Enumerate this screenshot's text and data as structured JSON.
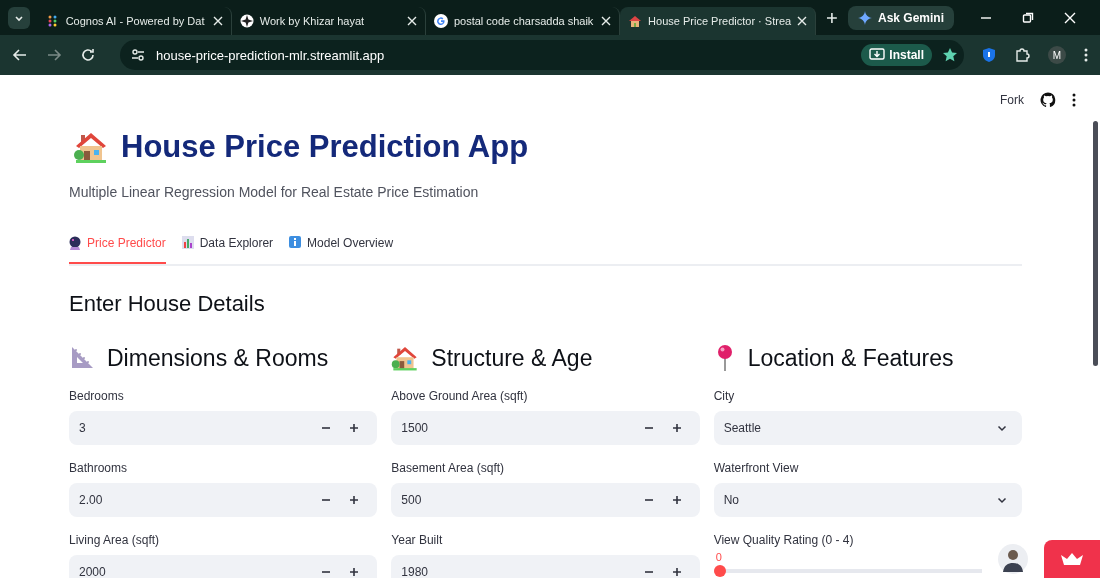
{
  "browser": {
    "tabs": [
      {
        "title": "Cognos AI - Powered by Dat",
        "selected": false
      },
      {
        "title": "Work by Khizar hayat",
        "selected": false
      },
      {
        "title": "postal code charsadda shaik",
        "selected": false
      },
      {
        "title": "House Price Predictor · Strea",
        "selected": true
      }
    ],
    "ask_button": "Ask Gemini",
    "address": "house-price-prediction-mlr.streamlit.app",
    "install_button": "Install",
    "profile_initial": "M"
  },
  "app_toolbar": {
    "fork": "Fork"
  },
  "header": {
    "title": "House Price Prediction App",
    "subtitle": "Multiple Linear Regression Model for Real Estate Price Estimation"
  },
  "tabs": [
    {
      "label": "Price Predictor",
      "selected": true
    },
    {
      "label": "Data Explorer",
      "selected": false
    },
    {
      "label": "Model Overview",
      "selected": false
    }
  ],
  "section_title": "Enter House Details",
  "columns": [
    {
      "heading": "Dimensions & Rooms",
      "fields": [
        {
          "kind": "number",
          "label": "Bedrooms",
          "value": "3"
        },
        {
          "kind": "number",
          "label": "Bathrooms",
          "value": "2.00"
        },
        {
          "kind": "number",
          "label": "Living Area (sqft)",
          "value": "2000"
        }
      ]
    },
    {
      "heading": "Structure & Age",
      "fields": [
        {
          "kind": "number",
          "label": "Above Ground Area (sqft)",
          "value": "1500"
        },
        {
          "kind": "number",
          "label": "Basement Area (sqft)",
          "value": "500"
        },
        {
          "kind": "number",
          "label": "Year Built",
          "value": "1980"
        }
      ]
    },
    {
      "heading": "Location & Features",
      "fields": [
        {
          "kind": "select",
          "label": "City",
          "value": "Seattle"
        },
        {
          "kind": "select",
          "label": "Waterfront View",
          "value": "No"
        },
        {
          "kind": "slider",
          "label": "View Quality Rating (0 - 4)",
          "reading": "0",
          "level": 0
        }
      ]
    }
  ]
}
